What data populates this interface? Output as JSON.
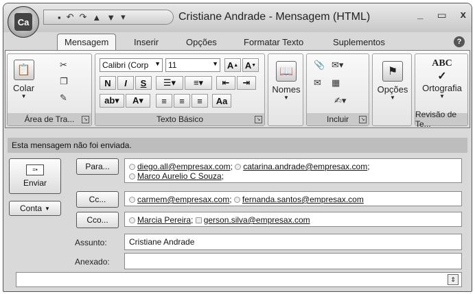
{
  "window": {
    "title": "Cristiane Andrade - Mensagem (HTML)",
    "office_button_label": "Ca",
    "controls": [
      "_",
      "▭",
      "x"
    ]
  },
  "tabs": [
    {
      "label": "Mensagem",
      "active": true
    },
    {
      "label": "Inserir",
      "active": false
    },
    {
      "label": "Opções",
      "active": false
    },
    {
      "label": "Formatar Texto",
      "active": false
    },
    {
      "label": "Suplementos",
      "active": false
    }
  ],
  "ribbon": {
    "clipboard": {
      "paste_label": "Colar",
      "group_label": "Área de Tra..."
    },
    "basic_text": {
      "font_name": "Calibri (Corp",
      "font_size": "11",
      "bold": "N",
      "italic": "I",
      "underline": "S",
      "group_label": "Texto Básico"
    },
    "names": {
      "label": "Nomes"
    },
    "include": {
      "group_label": "Incluir"
    },
    "options": {
      "label": "Opções"
    },
    "proofing": {
      "label": "Ortografia",
      "icon_text": "ABC",
      "group_label": "Revisão de Te..."
    }
  },
  "message": {
    "infobar": "Esta mensagem não foi enviada.",
    "send_label": "Enviar",
    "account_label": "Conta",
    "to_button": "Para...",
    "cc_button": "Cc...",
    "bcc_button": "Cco...",
    "to_recipients": [
      "diego.all@empresax.com",
      "catarina.andrade@empresax.com",
      "Marco Aurelio C Souza"
    ],
    "cc_recipients": [
      "carmem@empresax.com",
      "fernanda.santos@empresax.com"
    ],
    "bcc_recipients": [
      "Marcia Pereira",
      "gerson.silva@empresax.com"
    ],
    "subject_label": "Assunto:",
    "subject_value": "Cristiane Andrade",
    "attached_label": "Anexado:",
    "attached_value": ""
  }
}
